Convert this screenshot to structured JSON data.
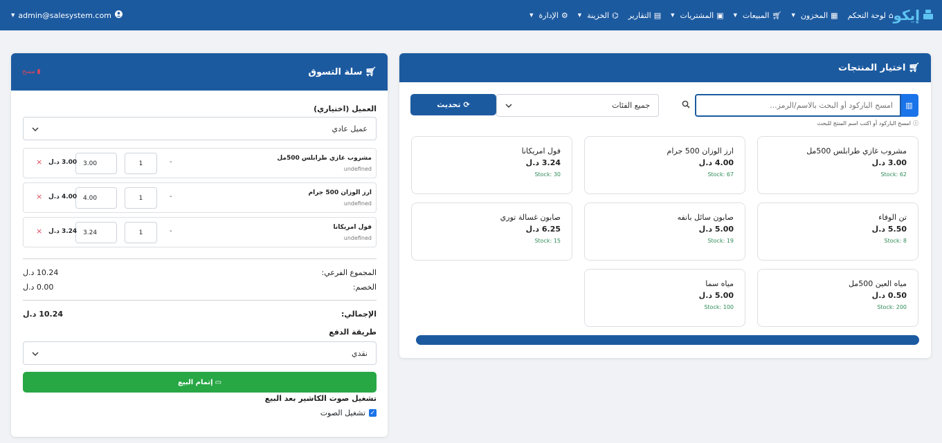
{
  "nav": {
    "brand": "إيكو",
    "items": [
      {
        "label": "لوحة التحكم",
        "icon": "home-icon",
        "caret": false
      },
      {
        "label": "المخزون",
        "icon": "boxes-icon",
        "caret": true
      },
      {
        "label": "المبيعات",
        "icon": "cart-icon",
        "caret": true
      },
      {
        "label": "المشتريات",
        "icon": "bag-icon",
        "caret": true
      },
      {
        "label": "التقارير",
        "icon": "report-icon",
        "caret": false
      },
      {
        "label": "الخزينة",
        "icon": "bank-icon",
        "caret": true
      },
      {
        "label": "الإدارة",
        "icon": "gear-icon",
        "caret": true
      }
    ],
    "user": "admin@salesystem.com"
  },
  "products": {
    "title": "اختيار المنتجات",
    "search_placeholder": "امسح الباركود أو البحث بالاسم/الرمز...",
    "category_selected": "جميع الفئات",
    "refresh_label": "تحديث",
    "hint": "امسح الباركود أو اكتب اسم المنتج للبحث",
    "items": [
      {
        "name": "مشروب غازي طرابلس 500مل",
        "price": "3.00 د.ل",
        "stock": "Stock: 62"
      },
      {
        "name": "ارز الوزان 500 جرام",
        "price": "4.00 د.ل",
        "stock": "Stock: 67"
      },
      {
        "name": "فول امريكانا",
        "price": "3.24 د.ل",
        "stock": "Stock: 30"
      },
      {
        "name": "تن الوفاء",
        "price": "5.50 د.ل",
        "stock": "Stock: 8"
      },
      {
        "name": "صابون سائل بانفه",
        "price": "5.00 د.ل",
        "stock": "Stock: 19"
      },
      {
        "name": "صابون غسالة توري",
        "price": "6.25 د.ل",
        "stock": "Stock: 15"
      },
      {
        "name": "مياه العين 500مل",
        "price": "0.50 د.ل",
        "stock": "Stock: 200"
      },
      {
        "name": "مياه سما",
        "price": "5.00 د.ل",
        "stock": "Stock: 100"
      }
    ]
  },
  "cart": {
    "title": "سلة التسوق",
    "clear_label": "مسح",
    "customer_label": "العميل (اختياري)",
    "customer_selected": "عميل عادي",
    "items": [
      {
        "name": "مشروب غازي طرابلس 500مل",
        "sub": "undefined",
        "dash": "-",
        "qty": "1",
        "price": "3.00",
        "total": "3.00 د.ل",
        "remove": "×"
      },
      {
        "name": "ارز الوزان 500 جرام",
        "sub": "undefined",
        "dash": "-",
        "qty": "1",
        "price": "4.00",
        "total": "4.00 د.ل",
        "remove": "×"
      },
      {
        "name": "فول امريكانا",
        "sub": "undefined",
        "dash": "-",
        "qty": "1",
        "price": "3.24",
        "total": "3.24 د.ل",
        "remove": "×"
      }
    ],
    "subtotal_label": "المجموع الفرعي:",
    "subtotal_value": "10.24 د.ل",
    "discount_label": "الخصم:",
    "discount_value": "0.00 د.ل",
    "total_label": "الإجمالي:",
    "total_value": "10.24 د.ل",
    "payment_label": "طريقة الدفع",
    "payment_selected": "نقدي",
    "complete_label": "إتمام البيع",
    "sound_heading": "تشغيل صوت الكاشير بعد البيع",
    "sound_checkbox_label": "تشغيل الصوت"
  }
}
